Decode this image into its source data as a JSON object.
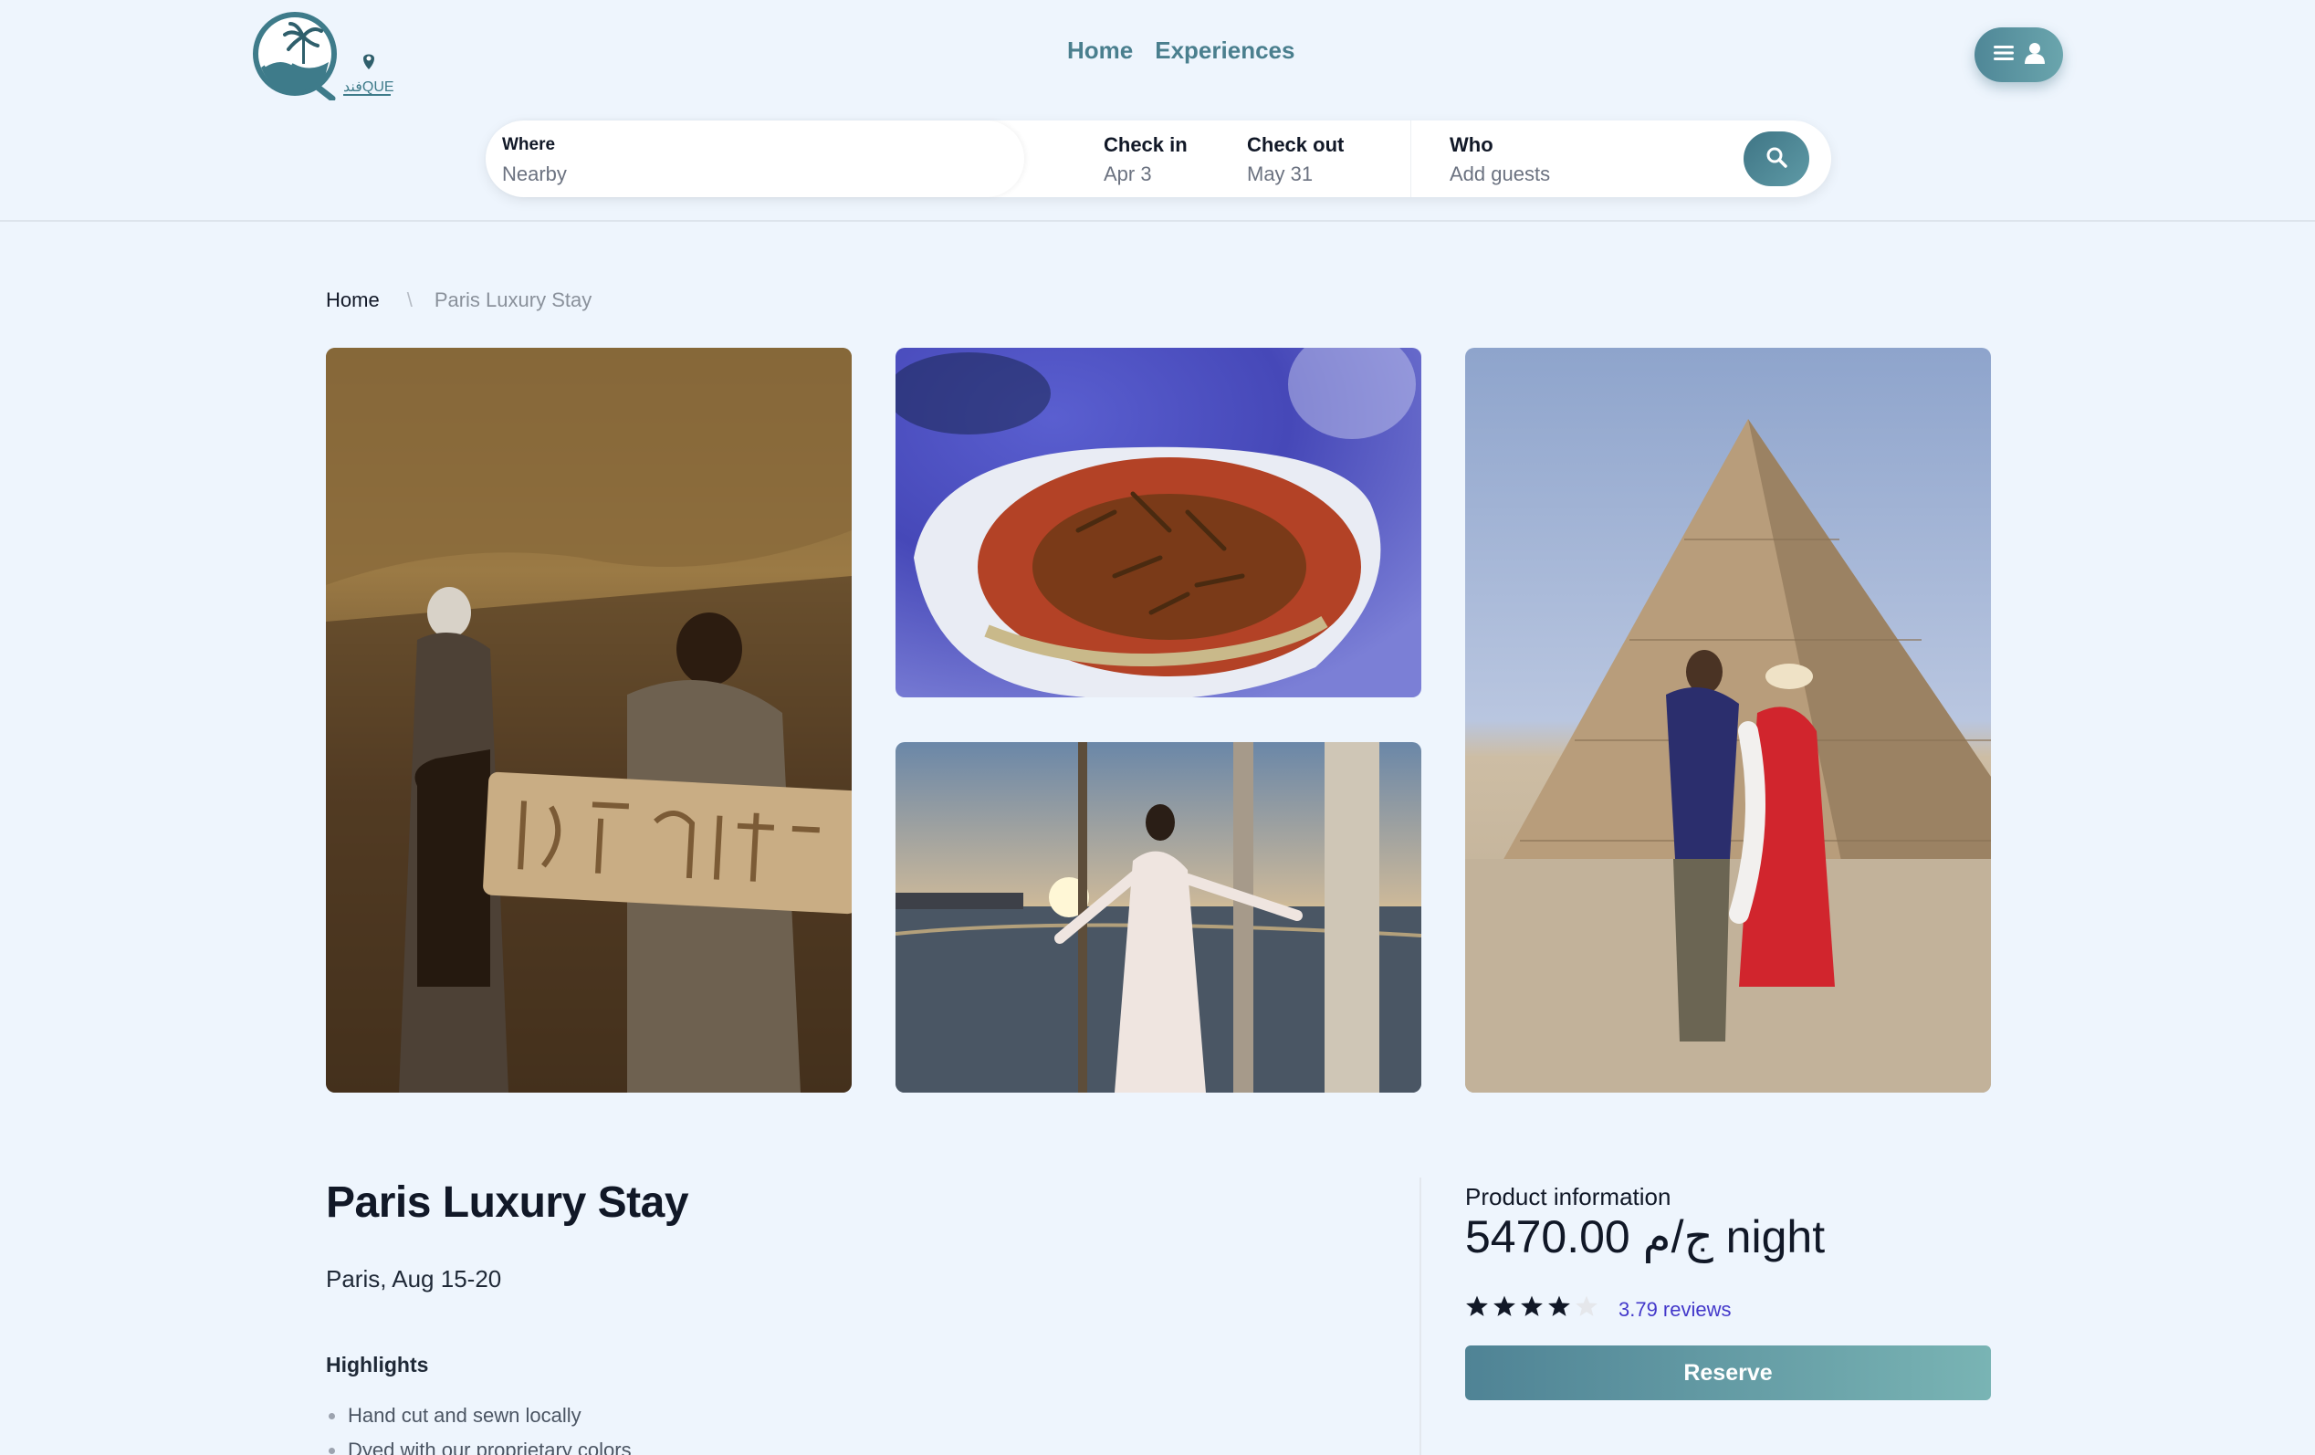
{
  "nav": {
    "home": "Home",
    "experiences": "Experiences"
  },
  "logo": {
    "text": "فندQUE",
    "icon": "palm-wave-pin-logo"
  },
  "search": {
    "where_label": "Where",
    "where_value": "Nearby",
    "checkin_label": "Check in",
    "checkin_value": "Apr 3",
    "checkout_label": "Check out",
    "checkout_value": "May 31",
    "who_label": "Who",
    "who_value": "Add guests"
  },
  "breadcrumb": {
    "home": "Home",
    "separator": "\\",
    "current": "Paris Luxury Stay"
  },
  "gallery": [
    {
      "subject": "tomb-guide-with-carved-stone"
    },
    {
      "subject": "koshary-dish"
    },
    {
      "subject": "felucca-sunset"
    },
    {
      "subject": "couple-at-pyramid"
    }
  ],
  "listing": {
    "title": "Paris Luxury Stay",
    "subtitle": "Paris, Aug 15-20",
    "highlights_title": "Highlights",
    "highlights": [
      "Hand cut and sewn locally",
      "Dyed with our proprietary colors"
    ]
  },
  "product": {
    "label": "Product information",
    "price": "5470.00 ج/م night",
    "rating": 4,
    "rating_max": 5,
    "reviews": "3.79 reviews",
    "reserve": "Reserve"
  },
  "colors": {
    "accent": "#4f8797",
    "background": "#eef5fd",
    "link": "#4338ca"
  }
}
